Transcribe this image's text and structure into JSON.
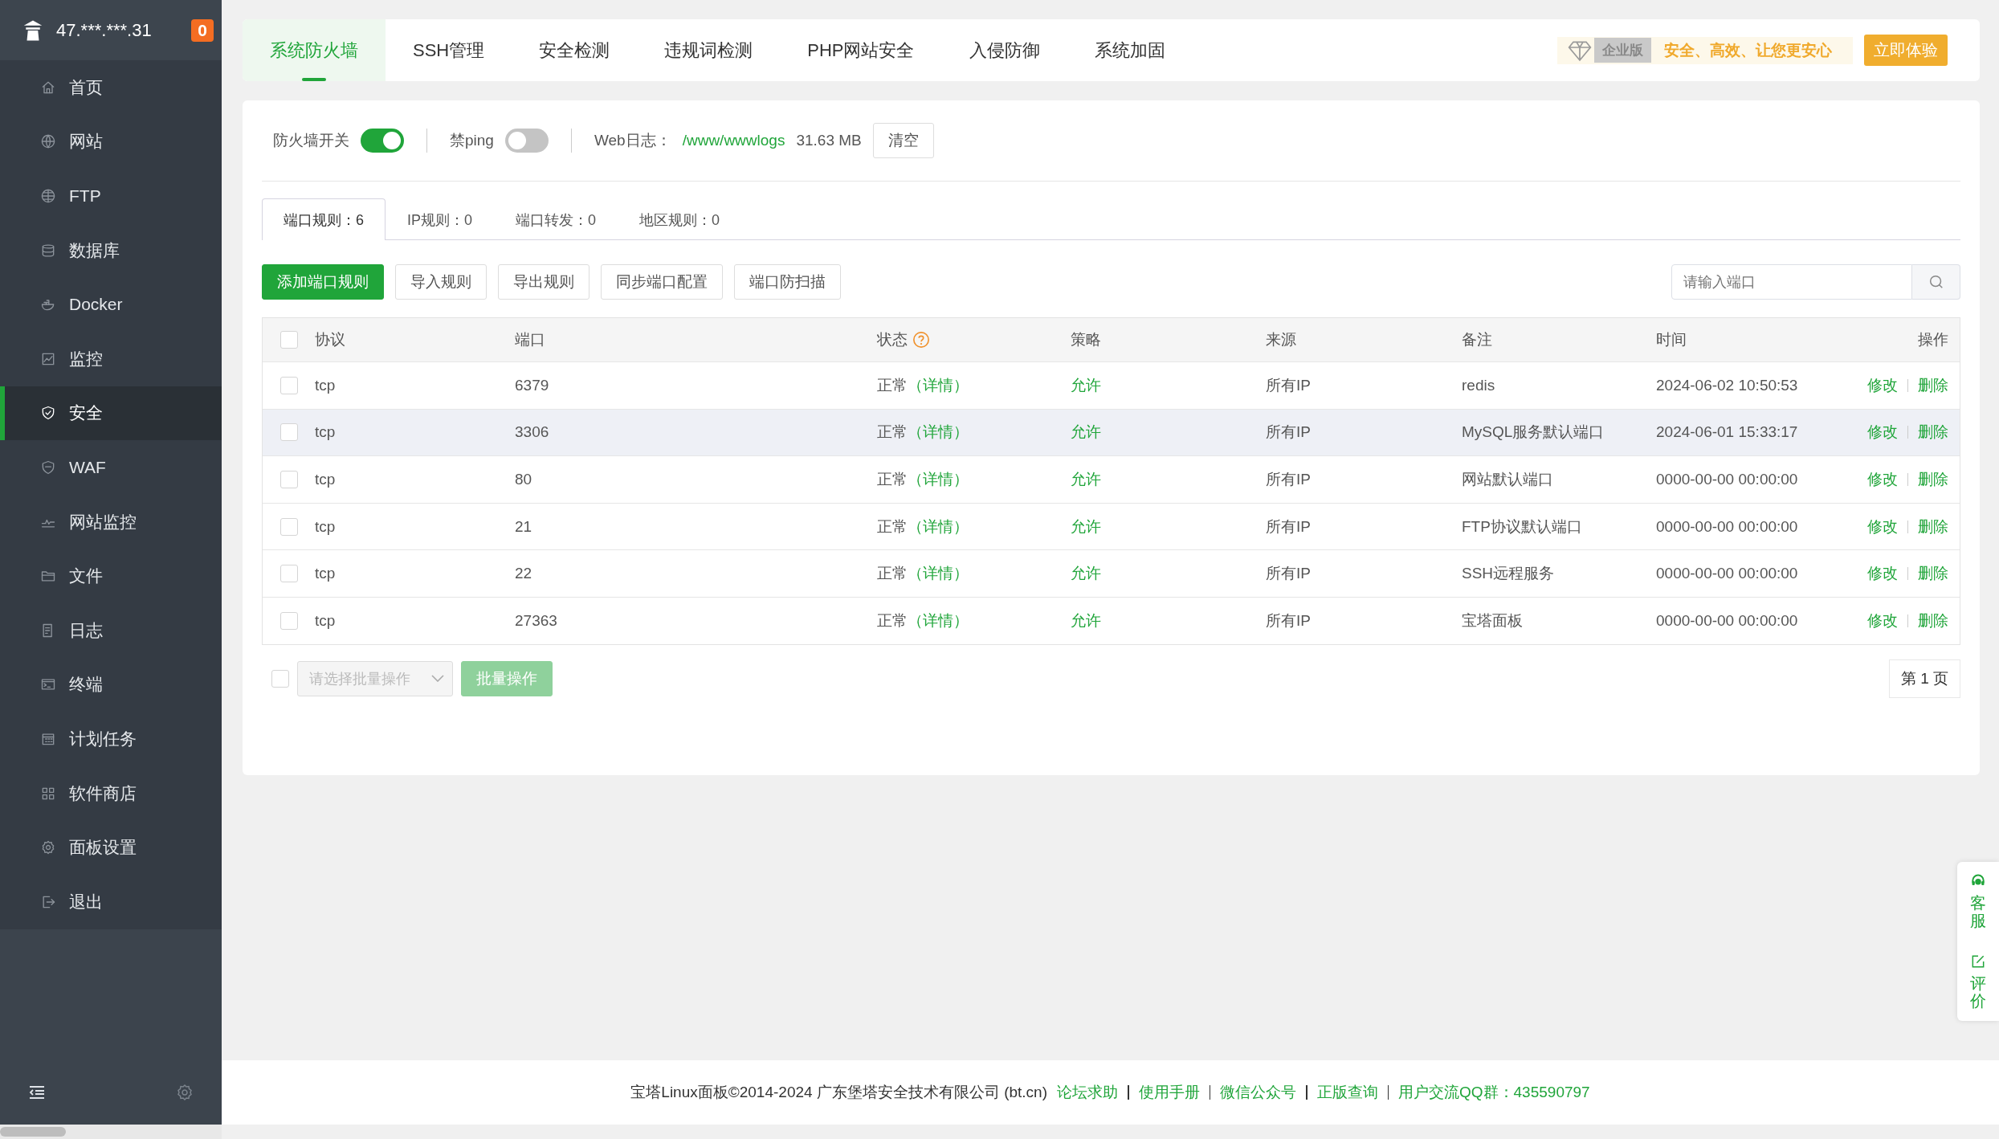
{
  "sidebar": {
    "server": "47.***.***.31",
    "badge": "0",
    "items": [
      {
        "label": "首页",
        "selected": false
      },
      {
        "label": "网站",
        "selected": false
      },
      {
        "label": "FTP",
        "selected": false
      },
      {
        "label": "数据库",
        "selected": false
      },
      {
        "label": "Docker",
        "selected": false
      },
      {
        "label": "监控",
        "selected": false
      },
      {
        "label": "安全",
        "selected": true
      },
      {
        "label": "WAF",
        "selected": false
      },
      {
        "label": "网站监控",
        "selected": false
      },
      {
        "label": "文件",
        "selected": false
      },
      {
        "label": "日志",
        "selected": false
      },
      {
        "label": "终端",
        "selected": false
      },
      {
        "label": "计划任务",
        "selected": false
      },
      {
        "label": "软件商店",
        "selected": false
      },
      {
        "label": "面板设置",
        "selected": false
      },
      {
        "label": "退出",
        "selected": false
      }
    ]
  },
  "tabs": [
    {
      "label": "系统防火墙",
      "selected": true
    },
    {
      "label": "SSH管理",
      "selected": false
    },
    {
      "label": "安全检测",
      "selected": false
    },
    {
      "label": "违规词检测",
      "selected": false
    },
    {
      "label": "PHP网站安全",
      "selected": false
    },
    {
      "label": "入侵防御",
      "selected": false
    },
    {
      "label": "系统加固",
      "selected": false
    }
  ],
  "promo": {
    "edition": "企业版",
    "slogan": "安全、高效、让您更安心",
    "button": "立即体验"
  },
  "settings": {
    "firewall": {
      "label": "防火墙开关",
      "on": true
    },
    "ping": {
      "label": "禁ping",
      "on": false
    },
    "log_label": "Web日志：",
    "log_path": "/www/wwwlogs",
    "log_size": "31.63 MB",
    "clear_button": "清空"
  },
  "rule_tabs": [
    {
      "label": "端口规则：6",
      "selected": true
    },
    {
      "label": "IP规则：0",
      "selected": false
    },
    {
      "label": "端口转发：0",
      "selected": false
    },
    {
      "label": "地区规则：0",
      "selected": false
    }
  ],
  "actions": [
    {
      "label": "添加端口规则",
      "kind": "primary"
    },
    {
      "label": "导入规则",
      "kind": "default"
    },
    {
      "label": "导出规则",
      "kind": "default"
    },
    {
      "label": "同步端口配置",
      "kind": "default"
    },
    {
      "label": "端口防扫描",
      "kind": "default"
    }
  ],
  "search": {
    "placeholder": "请输入端口"
  },
  "table": {
    "all_checked": false,
    "columns": [
      "协议",
      "端口",
      "状态",
      "策略",
      "来源",
      "备注",
      "时间",
      "操作"
    ],
    "rows": [
      {
        "checked": false,
        "highlighted": false,
        "protocol": "tcp",
        "port": "6379",
        "status": "正常",
        "detail": "（详情）",
        "policy": "允许",
        "source": "所有IP",
        "note": "redis",
        "time": "2024-06-02 10:50:53",
        "edit": "修改",
        "delete": "删除"
      },
      {
        "checked": false,
        "highlighted": true,
        "protocol": "tcp",
        "port": "3306",
        "status": "正常",
        "detail": "（详情）",
        "policy": "允许",
        "source": "所有IP",
        "note": "MySQL服务默认端口",
        "time": "2024-06-01 15:33:17",
        "edit": "修改",
        "delete": "删除"
      },
      {
        "checked": false,
        "highlighted": false,
        "protocol": "tcp",
        "port": "80",
        "status": "正常",
        "detail": "（详情）",
        "policy": "允许",
        "source": "所有IP",
        "note": "网站默认端口",
        "time": "0000-00-00 00:00:00",
        "edit": "修改",
        "delete": "删除"
      },
      {
        "checked": false,
        "highlighted": false,
        "protocol": "tcp",
        "port": "21",
        "status": "正常",
        "detail": "（详情）",
        "policy": "允许",
        "source": "所有IP",
        "note": "FTP协议默认端口",
        "time": "0000-00-00 00:00:00",
        "edit": "修改",
        "delete": "删除"
      },
      {
        "checked": false,
        "highlighted": false,
        "protocol": "tcp",
        "port": "22",
        "status": "正常",
        "detail": "（详情）",
        "policy": "允许",
        "source": "所有IP",
        "note": "SSH远程服务",
        "time": "0000-00-00 00:00:00",
        "edit": "修改",
        "delete": "删除"
      },
      {
        "checked": false,
        "highlighted": false,
        "protocol": "tcp",
        "port": "27363",
        "status": "正常",
        "detail": "（详情）",
        "policy": "允许",
        "source": "所有IP",
        "note": "宝塔面板",
        "time": "0000-00-00 00:00:00",
        "edit": "修改",
        "delete": "删除"
      }
    ]
  },
  "batch": {
    "checked": false,
    "placeholder": "请选择批量操作",
    "button": "批量操作"
  },
  "pagination": {
    "page": "第 1 页"
  },
  "footer": {
    "copyright": "宝塔Linux面板©2014-2024 广东堡塔安全技术有限公司 (bt.cn)",
    "links": [
      "论坛求助",
      "使用手册",
      "微信公众号",
      "正版查询",
      "用户交流QQ群：435590797"
    ]
  },
  "float_panel": {
    "items": [
      "客服",
      "评价"
    ]
  }
}
